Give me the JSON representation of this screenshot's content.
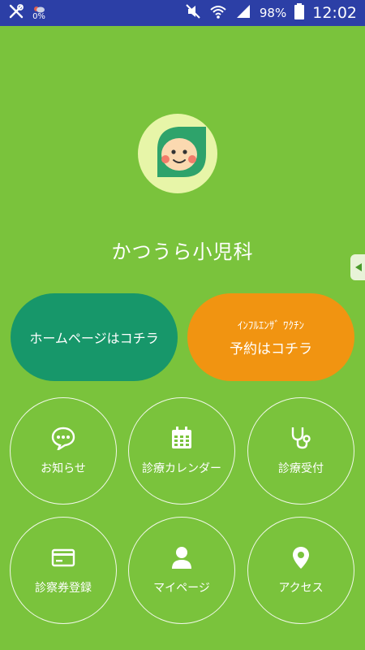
{
  "status_bar": {
    "weather_percent": "0%",
    "battery_percent": "98%",
    "time": "12:02",
    "icons": [
      "tools-icon",
      "weather-icon",
      "mute-icon",
      "wifi-icon",
      "signal-icon",
      "battery-icon"
    ]
  },
  "app": {
    "title": "かつうら小児科",
    "logo_icon": "leaf-baby-face-icon",
    "side_tab_icon": "arrow-left-icon"
  },
  "buttons": {
    "homepage": "ホームページはコチラ",
    "flu_line1": "ｲﾝﾌﾙｴﾝｻﾞ ﾜｸﾁﾝ",
    "flu_line2": "予約はコチラ"
  },
  "menu": [
    {
      "label": "お知らせ",
      "icon": "chat-bubble-icon"
    },
    {
      "label": "診療カレンダー",
      "icon": "calendar-icon"
    },
    {
      "label": "診療受付",
      "icon": "stethoscope-icon"
    },
    {
      "label": "診察券登録",
      "icon": "card-icon"
    },
    {
      "label": "マイページ",
      "icon": "person-icon"
    },
    {
      "label": "アクセス",
      "icon": "location-pin-icon"
    }
  ],
  "colors": {
    "background": "#7ac33c",
    "status_bar": "#2c3fa6",
    "homepage_button": "#17976a",
    "flu_button": "#f19411",
    "logo_bg": "#e7f5a8"
  }
}
